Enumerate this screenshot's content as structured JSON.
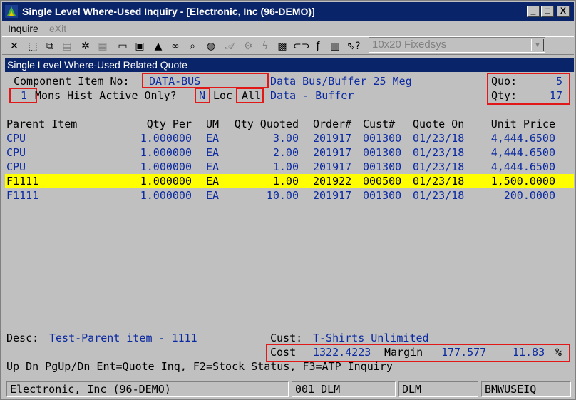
{
  "window": {
    "title": "Single Level Where-Used Inquiry - [Electronic, Inc (96-DEMO)]",
    "minimize_label": "_",
    "maximize_label": "□",
    "close_label": "X"
  },
  "menu": {
    "inquire": "Inquire",
    "exit": "eXit"
  },
  "toolbar": {
    "font_selector": "10x20 Fixedsys",
    "font_selector_arrow": "▼",
    "icons": [
      "close-icon",
      "select-icon",
      "copy-icon",
      "paste-icon",
      "settings-icon",
      "document-icon",
      "notes-icon",
      "print-icon",
      "alert-icon",
      "binoculars-icon",
      "magnify-icon",
      "globe-icon",
      "script-icon",
      "gear-icon",
      "lightning-icon",
      "calc-icon",
      "link-icon",
      "function-icon",
      "ledger-icon",
      "help-pointer-icon"
    ]
  },
  "screen": {
    "title": "Single Level Where-Used Related Quote",
    "component_label": "Component Item No:",
    "component_value": "DATA-BUS",
    "component_desc": "Data Bus/Buffer 25 Meg",
    "quo_label": "Quo:",
    "quo_value": "5",
    "qty_label": "Qty:",
    "qty_value": "17",
    "mons_value": "1",
    "mons_label": "Mons Hist Active Only?",
    "active_only_value": "N",
    "loc_label": "Loc",
    "loc_value": "All",
    "loc_desc": "Data - Buffer"
  },
  "table": {
    "headers": {
      "parent": "Parent Item",
      "qty_per": "Qty Per",
      "um": "UM",
      "qty_quoted": "Qty Quoted",
      "order": "Order#",
      "cust": "Cust#",
      "quote_on": "Quote On",
      "unit_price": "Unit Price"
    },
    "rows": [
      {
        "parent": "CPU",
        "qty_per": "1.000000",
        "um": "EA",
        "qty_quoted": "3.00",
        "order": "201917",
        "cust": "001300",
        "quote_on": "01/23/18",
        "unit_price": "4,444.6500"
      },
      {
        "parent": "CPU",
        "qty_per": "1.000000",
        "um": "EA",
        "qty_quoted": "2.00",
        "order": "201917",
        "cust": "001300",
        "quote_on": "01/23/18",
        "unit_price": "4,444.6500"
      },
      {
        "parent": "CPU",
        "qty_per": "1.000000",
        "um": "EA",
        "qty_quoted": "1.00",
        "order": "201917",
        "cust": "001300",
        "quote_on": "01/23/18",
        "unit_price": "4,444.6500"
      },
      {
        "parent": "F1111",
        "qty_per": "1.000000",
        "um": "EA",
        "qty_quoted": "1.00",
        "order": "201922",
        "cust": "000500",
        "quote_on": "01/23/18",
        "unit_price": "1,500.0000"
      },
      {
        "parent": "F1111",
        "qty_per": "1.000000",
        "um": "EA",
        "qty_quoted": "10.00",
        "order": "201917",
        "cust": "001300",
        "quote_on": "01/23/18",
        "unit_price": "200.0000"
      }
    ]
  },
  "footer": {
    "desc_label": "Desc:",
    "desc_value": "Test-Parent item - 1111",
    "cust_label": "Cust:",
    "cust_value": "T-Shirts Unlimited",
    "cost_label": "Cost",
    "cost_value": "1322.4223",
    "margin_label": "Margin",
    "margin_value": "177.577",
    "margin_pct": "11.83",
    "pct_sign": "%",
    "help_line": "Up Dn PgUp/Dn Ent=Quote Inq, F2=Stock Status, F3=ATP Inquiry"
  },
  "status": {
    "company": "Electronic, Inc (96-DEMO)",
    "user": "001 DLM",
    "user2": "DLM",
    "program": "BMWUSEIQ"
  }
}
